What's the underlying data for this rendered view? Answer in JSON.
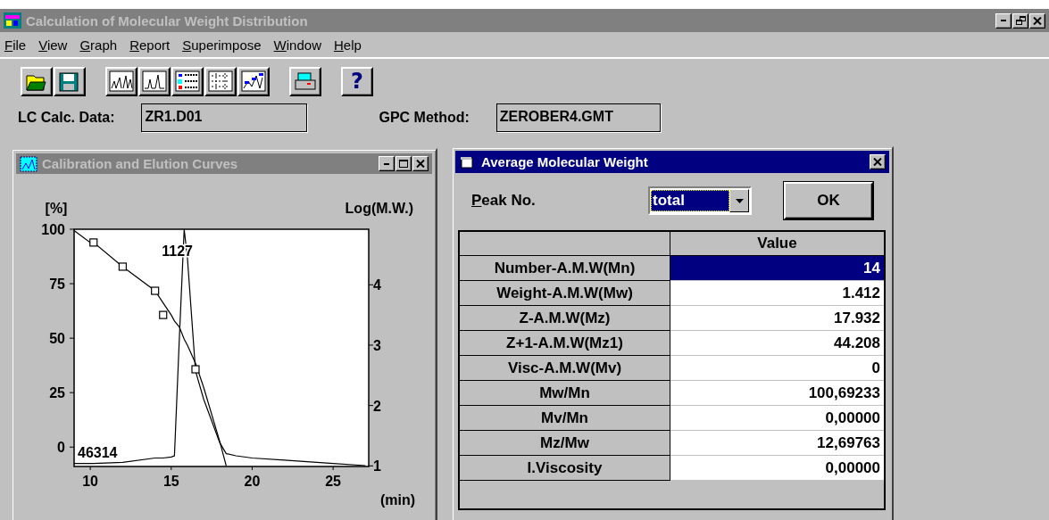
{
  "window": {
    "title": "Calculation of Molecular Weight Distribution",
    "active": false
  },
  "menu": [
    {
      "label": "File",
      "underlined": true
    },
    {
      "label": "View",
      "underlined": true
    },
    {
      "label": "Graph",
      "underlined": true
    },
    {
      "label": "Report",
      "underlined": true
    },
    {
      "label": "Superimpose",
      "underlined": true
    },
    {
      "label": "Window",
      "underlined": true
    },
    {
      "label": "Help",
      "underlined": true
    }
  ],
  "toolbar": {
    "help_label": "?"
  },
  "fields": [
    {
      "label": "LC Calc. Data:",
      "value": "ZR1.D01"
    },
    {
      "label": "GPC Method:",
      "value": "ZEROBER4.GMT"
    }
  ],
  "chart_window": {
    "title": "Calibration and Elution Curves",
    "active": false,
    "chart_data": {
      "type": "line",
      "xlabel": "(min)",
      "ylabel": "[%]",
      "y2label": "Log(M.W.)",
      "x": [
        9,
        10,
        10.2,
        12,
        14,
        14.5,
        15,
        15.2,
        15.5,
        15.8,
        16,
        16.5,
        17,
        18,
        18.4,
        19,
        20,
        22,
        25,
        27
      ],
      "xlim": [
        9,
        27.2
      ],
      "ylim": [
        -8.9,
        100
      ],
      "y2lim": [
        0.99,
        4.92
      ],
      "xticks": [
        10,
        15,
        20,
        25
      ],
      "yticks": [
        0,
        25,
        50,
        75,
        100
      ],
      "y2ticks": [
        1,
        2,
        3,
        4
      ],
      "series": [
        {
          "values": [
            -7.5,
            -7.5,
            -7.5,
            -7,
            -5,
            -5,
            -4.5,
            -4,
            50,
            100,
            87,
            35,
            22,
            2,
            -3,
            -4,
            -5,
            -6,
            -7.5,
            -8.5
          ]
        },
        {
          "axis": "y2",
          "values": [
            4.9,
            4.7,
            4.7,
            4.3,
            3.9,
            3.7,
            3.5,
            3.4,
            3.3,
            3.1,
            3.0,
            2.7,
            2.3,
            1.4,
            1.0,
            null,
            null,
            null,
            null,
            null
          ]
        },
        {
          "axis": "y2",
          "type": "scatter",
          "values": [
            null,
            null,
            4.7,
            4.3,
            3.9,
            3.5,
            null,
            null,
            null,
            null,
            null,
            2.6,
            null,
            null,
            null,
            null,
            null,
            null,
            null,
            null
          ]
        }
      ],
      "annotations": [
        "1127",
        "46314"
      ]
    }
  },
  "dialog": {
    "title": "Average Molecular Weight",
    "active": true,
    "peak_label": "Peak No.",
    "peak_label_underlined": true,
    "peak_value": "total",
    "ok": "OK",
    "value_column": "Value",
    "rows": [
      {
        "name": "Number-A.M.W(Mn)",
        "value": "14",
        "selected": true
      },
      {
        "name": "Weight-A.M.W(Mw)",
        "value": "1.412",
        "selected": false
      },
      {
        "name": "Z-A.M.W(Mz)",
        "value": "17.932",
        "selected": false
      },
      {
        "name": "Z+1-A.M.W(Mz1)",
        "value": "44.208",
        "selected": false
      },
      {
        "name": "Visc-A.M.W(Mv)",
        "value": "0",
        "selected": false
      },
      {
        "name": "Mw/Mn",
        "value": "100,69233",
        "selected": false
      },
      {
        "name": "Mv/Mn",
        "value": "0,00000",
        "selected": false
      },
      {
        "name": "Mz/Mw",
        "value": "12,69763",
        "selected": false
      },
      {
        "name": "I.Viscosity",
        "value": "0,00000",
        "selected": false
      }
    ]
  }
}
